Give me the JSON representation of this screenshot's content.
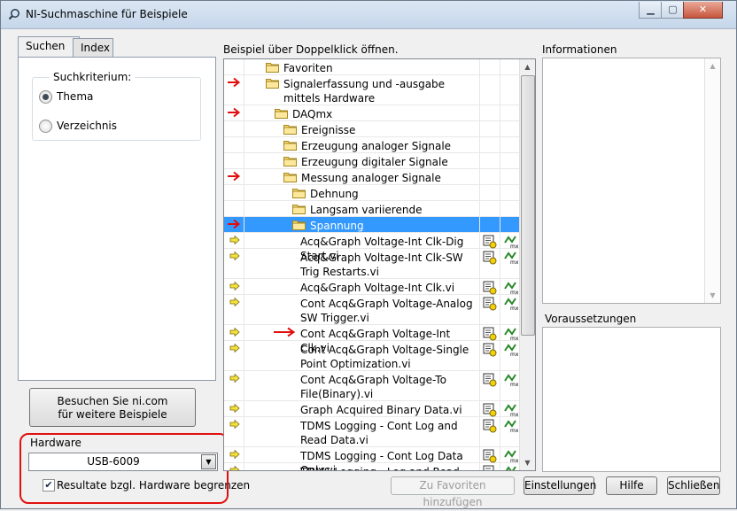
{
  "window": {
    "title": "NI-Suchmaschine für Beispiele"
  },
  "tabs": [
    {
      "label": "Suchen",
      "active": true
    },
    {
      "label": "Index",
      "active": false
    }
  ],
  "search_criteria": {
    "label": "Suchkriterium:",
    "options": [
      {
        "label": "Thema",
        "selected": true
      },
      {
        "label": "Verzeichnis",
        "selected": false
      }
    ]
  },
  "visit_button": {
    "line1": "Besuchen Sie ni.com",
    "line2": "für weitere Beispiele"
  },
  "hardware": {
    "label": "Hardware",
    "selected": "USB-6009",
    "limit_checkbox_label": "Resultate bzgl. Hardware begrenzen",
    "limit_checked": true
  },
  "tree": {
    "label": "Beispiel über Doppelklick öffnen.",
    "items": [
      {
        "text": "Favoriten",
        "type": "folder",
        "level": 0,
        "annotated": false
      },
      {
        "text": "Signalerfassung und -ausgabe mittels Hardware",
        "type": "folder",
        "level": 0,
        "annotated": true
      },
      {
        "text": "DAQmx",
        "type": "folder",
        "level": 1,
        "annotated": true
      },
      {
        "text": "Ereignisse",
        "type": "folder",
        "level": 2,
        "annotated": false
      },
      {
        "text": "Erzeugung analoger Signale",
        "type": "folder",
        "level": 2,
        "annotated": false
      },
      {
        "text": "Erzeugung digitaler Signale",
        "type": "folder",
        "level": 2,
        "annotated": false
      },
      {
        "text": "Messung analoger Signale",
        "type": "folder",
        "level": 2,
        "annotated": true
      },
      {
        "text": "Dehnung",
        "type": "folder",
        "level": 3,
        "annotated": false
      },
      {
        "text": "Langsam variierende Spannungssignale",
        "type": "folder",
        "level": 3,
        "annotated": false
      },
      {
        "text": "Spannung",
        "type": "folder",
        "level": 3,
        "annotated": true,
        "selected": true
      },
      {
        "text": "Acq&Graph Voltage-Int Clk-Dig Start.vi",
        "type": "vi",
        "level": 4,
        "annotated": false
      },
      {
        "text": "Acq&Graph Voltage-Int Clk-SW Trig Restarts.vi",
        "type": "vi",
        "level": 4,
        "annotated": false
      },
      {
        "text": "Acq&Graph Voltage-Int Clk.vi",
        "type": "vi",
        "level": 4,
        "annotated": false
      },
      {
        "text": "Cont Acq&Graph Voltage-Analog SW Trigger.vi",
        "type": "vi",
        "level": 4,
        "annotated": false
      },
      {
        "text": "Cont Acq&Graph Voltage-Int Clk.vi",
        "type": "vi",
        "level": 4,
        "annotated": true
      },
      {
        "text": "Cont Acq&Graph Voltage-Single Point Optimization.vi",
        "type": "vi",
        "level": 4,
        "annotated": false
      },
      {
        "text": "Cont Acq&Graph Voltage-To File(Binary).vi",
        "type": "vi",
        "level": 4,
        "annotated": false
      },
      {
        "text": "Graph Acquired Binary Data.vi",
        "type": "vi",
        "level": 4,
        "annotated": false
      },
      {
        "text": "TDMS Logging - Cont Log and Read Data.vi",
        "type": "vi",
        "level": 4,
        "annotated": false
      },
      {
        "text": "TDMS Logging - Cont Log Data Only.vi",
        "type": "vi",
        "level": 4,
        "annotated": false
      },
      {
        "text": "TDMS Logging - Log and Read Data.vi",
        "type": "vi",
        "level": 4,
        "annotated": false
      }
    ]
  },
  "info": {
    "label": "Informationen"
  },
  "requirements": {
    "label": "Voraussetzungen"
  },
  "buttons": {
    "add_favorite": "Zu Favoriten hinzufügen",
    "settings": "Einstellungen",
    "help": "Hilfe",
    "close": "Schließen"
  },
  "colors": {
    "selection": "#3399ff",
    "annotation": "#e01010"
  }
}
